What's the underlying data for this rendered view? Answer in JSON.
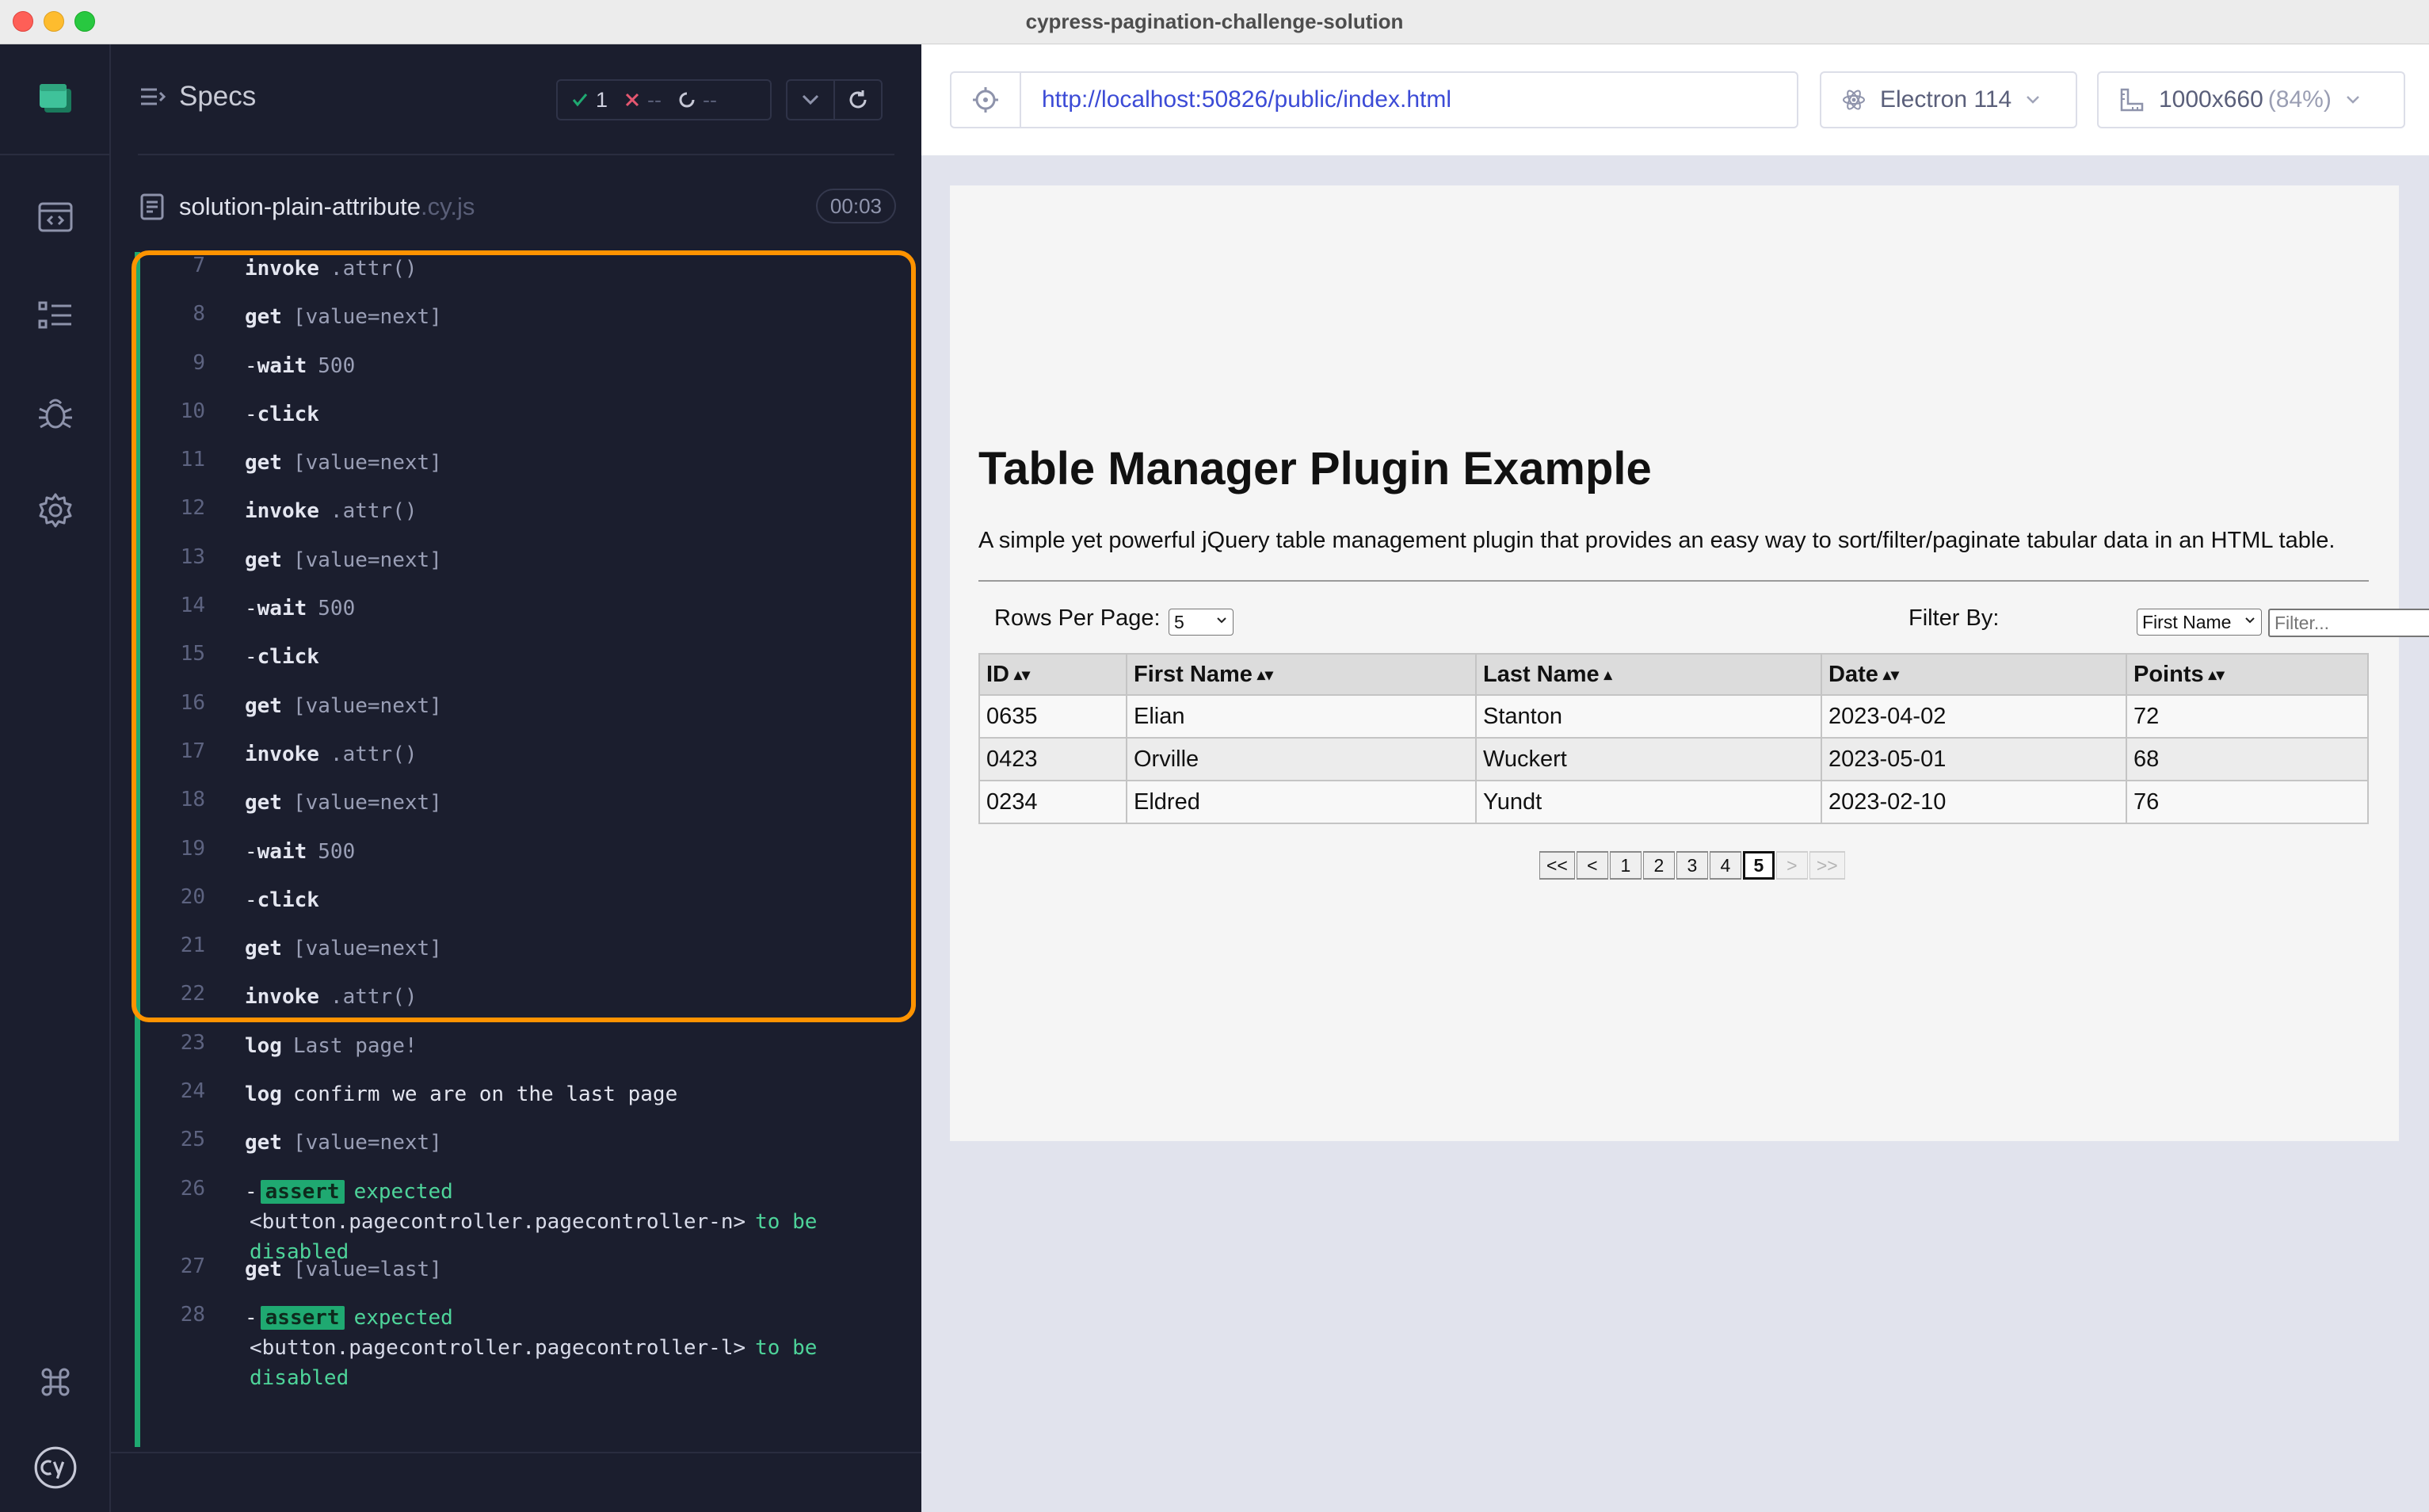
{
  "window": {
    "title": "cypress-pagination-challenge-solution"
  },
  "specs": {
    "title": "Specs",
    "stats": {
      "passed": "1",
      "failed": "--",
      "pending": "--"
    },
    "spec_name": "solution-plain-attribute",
    "spec_ext": ".cy.js",
    "duration": "00:03"
  },
  "commands": [
    {
      "num": "7",
      "name": "invoke",
      "dash": "",
      "msg": ".attr()",
      "bright": false
    },
    {
      "num": "8",
      "name": "get",
      "dash": "",
      "msg": "[value=next]",
      "bright": false
    },
    {
      "num": "9",
      "name": "wait",
      "dash": "-",
      "msg": "500",
      "bright": false
    },
    {
      "num": "10",
      "name": "click",
      "dash": "-",
      "msg": "",
      "bright": false
    },
    {
      "num": "11",
      "name": "get",
      "dash": "",
      "msg": "[value=next]",
      "bright": false
    },
    {
      "num": "12",
      "name": "invoke",
      "dash": "",
      "msg": ".attr()",
      "bright": false
    },
    {
      "num": "13",
      "name": "get",
      "dash": "",
      "msg": "[value=next]",
      "bright": false
    },
    {
      "num": "14",
      "name": "wait",
      "dash": "-",
      "msg": "500",
      "bright": false
    },
    {
      "num": "15",
      "name": "click",
      "dash": "-",
      "msg": "",
      "bright": false
    },
    {
      "num": "16",
      "name": "get",
      "dash": "",
      "msg": "[value=next]",
      "bright": false
    },
    {
      "num": "17",
      "name": "invoke",
      "dash": "",
      "msg": ".attr()",
      "bright": false
    },
    {
      "num": "18",
      "name": "get",
      "dash": "",
      "msg": "[value=next]",
      "bright": false
    },
    {
      "num": "19",
      "name": "wait",
      "dash": "-",
      "msg": "500",
      "bright": false
    },
    {
      "num": "20",
      "name": "click",
      "dash": "-",
      "msg": "",
      "bright": false
    },
    {
      "num": "21",
      "name": "get",
      "dash": "",
      "msg": "[value=next]",
      "bright": false
    },
    {
      "num": "22",
      "name": "invoke",
      "dash": "",
      "msg": ".attr()",
      "bright": false
    },
    {
      "num": "23",
      "name": "log",
      "dash": "",
      "msg": "Last page!",
      "bright": false
    },
    {
      "num": "24",
      "name": "log",
      "dash": "",
      "msg": "confirm we are on the last page",
      "bright": true
    },
    {
      "num": "25",
      "name": "get",
      "dash": "",
      "msg": "[value=next]",
      "bright": false
    }
  ],
  "asserts": [
    {
      "num": "26",
      "badge": "assert",
      "expected": "expected",
      "element": "<button.pagecontroller.pagecontroller-n>",
      "to_be": "to be",
      "state": "disabled"
    },
    {
      "num": "27",
      "get_name": "get",
      "get_msg": "[value=last]"
    },
    {
      "num": "28",
      "badge": "assert",
      "expected": "expected",
      "element": "<button.pagecontroller.pagecontroller-l>",
      "to_be": "to be",
      "state": "disabled"
    }
  ],
  "aut": {
    "url": "http://localhost:50826/public/index.html",
    "browser": "Electron 114",
    "viewport": "1000x660",
    "viewport_scale": "(84%)"
  },
  "app": {
    "title": "Table Manager Plugin Example",
    "description": "A simple yet powerful jQuery table management plugin that provides an easy way to sort/filter/paginate tabular data in an HTML table.",
    "rows_label": "Rows Per Page:",
    "rows_value": "5",
    "filter_label": "Filter By:",
    "filter_value": "First Name",
    "filter_placeholder": "Filter...",
    "columns": [
      "ID",
      "First Name",
      "Last Name",
      "Date",
      "Points"
    ],
    "rows": [
      [
        "0635",
        "Elian",
        "Stanton",
        "2023-04-02",
        "72"
      ],
      [
        "0423",
        "Orville",
        "Wuckert",
        "2023-05-01",
        "68"
      ],
      [
        "0234",
        "Eldred",
        "Yundt",
        "2023-02-10",
        "76"
      ]
    ],
    "pager": {
      "first": "<<",
      "prev": "<",
      "pages": [
        "1",
        "2",
        "3",
        "4",
        "5"
      ],
      "current": "5",
      "next": ">",
      "last": ">>"
    }
  },
  "colors": {
    "pass": "#1fa971",
    "highlight": "#ff9300",
    "url": "#3c4bd6",
    "sidebar": "#1b1e2e"
  }
}
